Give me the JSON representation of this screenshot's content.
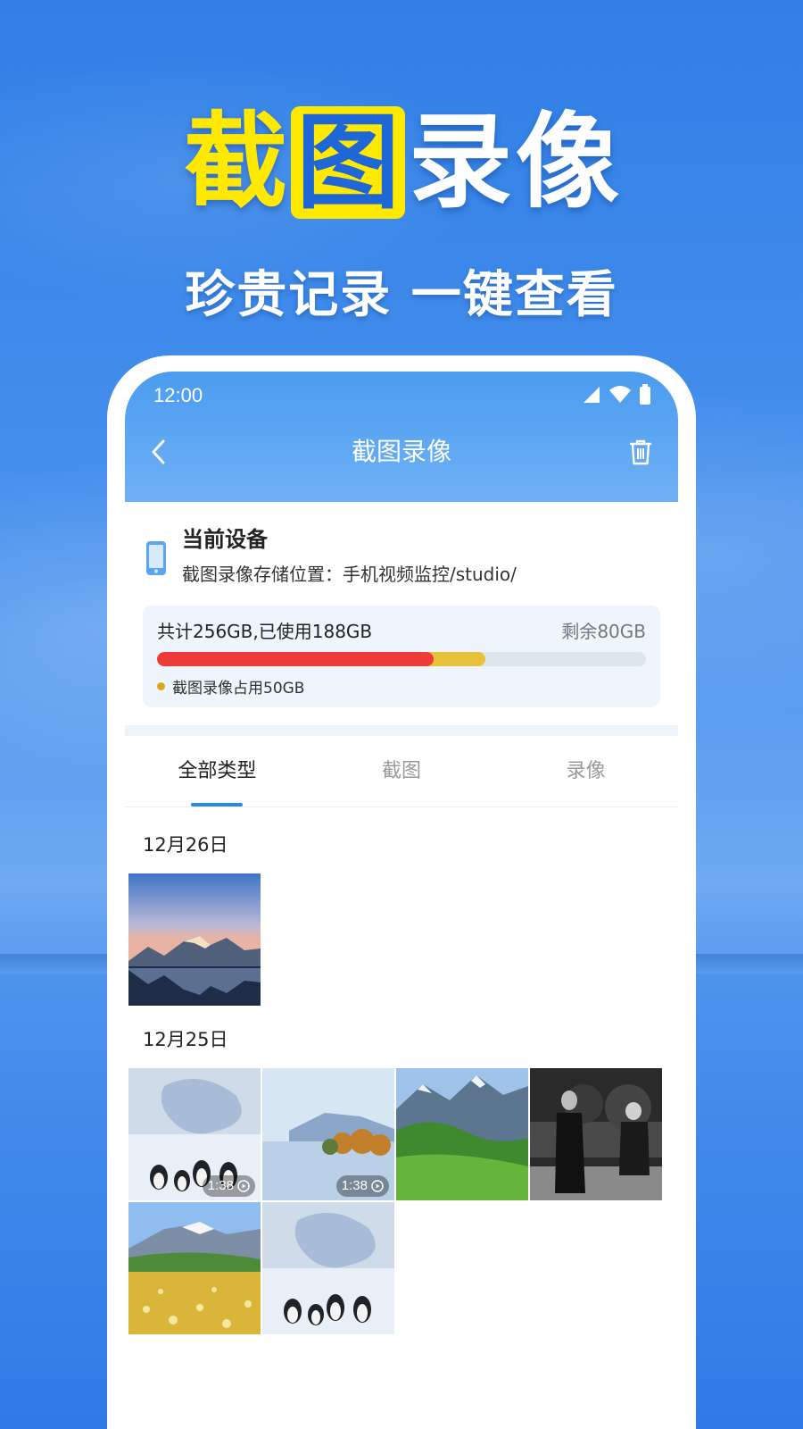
{
  "promo": {
    "title_chars": [
      "截",
      "图",
      "录",
      "像"
    ],
    "subtitle": "珍贵记录 一键查看"
  },
  "status_bar": {
    "time": "12:00"
  },
  "nav": {
    "title": "截图录像",
    "back_icon": "chevron-left-icon",
    "trash_icon": "trash-icon"
  },
  "device": {
    "title": "当前设备",
    "path": "截图录像存储位置：手机视频监控/studio/",
    "icon": "phone-icon"
  },
  "storage": {
    "total_text": "共计256GB,已使用188GB",
    "remaining_text": "剩余80GB",
    "used_fraction": 0.672,
    "media_fraction": 0.566,
    "legend": "截图录像占用50GB",
    "colors": {
      "media": "#ee3b38",
      "other": "#e8c13a",
      "track": "#dde6ef"
    }
  },
  "tabs": [
    {
      "label": "全部类型",
      "active": true
    },
    {
      "label": "截图",
      "active": false
    },
    {
      "label": "录像",
      "active": false
    }
  ],
  "groups": [
    {
      "date": "12月26日",
      "items": [
        {
          "kind": "image",
          "scene": "mountain-lake-sunset"
        }
      ]
    },
    {
      "date": "12月25日",
      "items": [
        {
          "kind": "video",
          "scene": "penguins-snow",
          "duration": "1:38"
        },
        {
          "kind": "video",
          "scene": "lake-autumn-trees",
          "duration": "1:38"
        },
        {
          "kind": "image",
          "scene": "green-mountains"
        },
        {
          "kind": "image",
          "scene": "bw-people-outdoor"
        },
        {
          "kind": "image",
          "scene": "flower-meadow-mountains"
        },
        {
          "kind": "image",
          "scene": "penguins-snow"
        }
      ]
    }
  ]
}
